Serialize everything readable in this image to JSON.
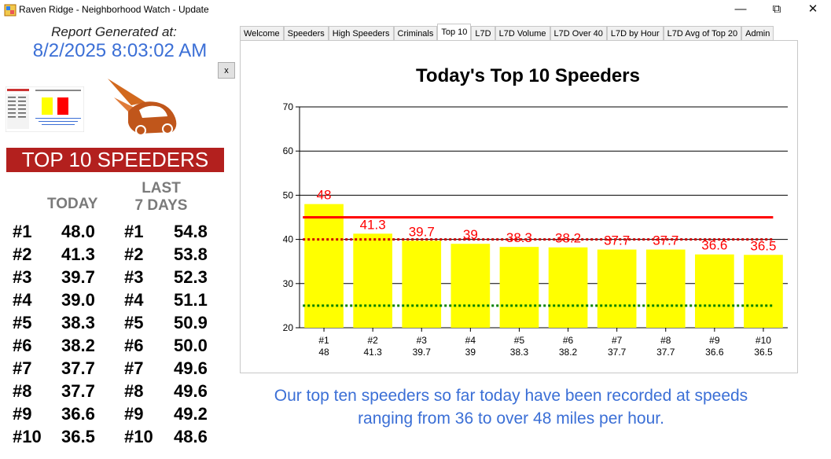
{
  "window": {
    "title": "Raven Ridge - Neighborhood Watch - Update"
  },
  "report": {
    "label": "Report Generated at:",
    "timestamp": "8/2/2025 8:03:02 AM",
    "close_label": "x"
  },
  "banner": {
    "text": "TOP 10 SPEEDERS"
  },
  "columns": {
    "today": "TODAY",
    "last_line1": "LAST",
    "last_line2": "7 DAYS"
  },
  "rankings": [
    {
      "today_rank": "#1",
      "today_speed": "48.0",
      "last_rank": "#1",
      "last_speed": "54.8"
    },
    {
      "today_rank": "#2",
      "today_speed": "41.3",
      "last_rank": "#2",
      "last_speed": "53.8"
    },
    {
      "today_rank": "#3",
      "today_speed": "39.7",
      "last_rank": "#3",
      "last_speed": "52.3"
    },
    {
      "today_rank": "#4",
      "today_speed": "39.0",
      "last_rank": "#4",
      "last_speed": "51.1"
    },
    {
      "today_rank": "#5",
      "today_speed": "38.3",
      "last_rank": "#5",
      "last_speed": "50.9"
    },
    {
      "today_rank": "#6",
      "today_speed": "38.2",
      "last_rank": "#6",
      "last_speed": "50.0"
    },
    {
      "today_rank": "#7",
      "today_speed": "37.7",
      "last_rank": "#7",
      "last_speed": "49.6"
    },
    {
      "today_rank": "#8",
      "today_speed": "37.7",
      "last_rank": "#8",
      "last_speed": "49.6"
    },
    {
      "today_rank": "#9",
      "today_speed": "36.6",
      "last_rank": "#9",
      "last_speed": "49.2"
    },
    {
      "today_rank": "#10",
      "today_speed": "36.5",
      "last_rank": "#10",
      "last_speed": "48.6"
    }
  ],
  "tabs": [
    {
      "label": "Welcome",
      "active": false
    },
    {
      "label": "Speeders",
      "active": false
    },
    {
      "label": "High Speeders",
      "active": false
    },
    {
      "label": "Criminals",
      "active": false
    },
    {
      "label": "Top 10",
      "active": true
    },
    {
      "label": "L7D",
      "active": false
    },
    {
      "label": "L7D Volume",
      "active": false
    },
    {
      "label": "L7D Over 40",
      "active": false
    },
    {
      "label": "L7D by Hour",
      "active": false
    },
    {
      "label": "L7D Avg of Top 20",
      "active": false
    },
    {
      "label": "Admin",
      "active": false
    }
  ],
  "chart_data": {
    "type": "bar",
    "title": "Today's Top 10 Speeders",
    "categories": [
      "#1",
      "#2",
      "#3",
      "#4",
      "#5",
      "#6",
      "#7",
      "#8",
      "#9",
      "#10"
    ],
    "category_sublabels": [
      "48",
      "41.3",
      "39.7",
      "39",
      "38.3",
      "38.2",
      "37.7",
      "37.7",
      "36.6",
      "36.5"
    ],
    "values": [
      48,
      41.3,
      39.7,
      39,
      38.3,
      38.2,
      37.7,
      37.7,
      36.6,
      36.5
    ],
    "data_labels": [
      "48",
      "41.3",
      "39.7",
      "39",
      "38.3",
      "38.2",
      "37.7",
      "37.7",
      "36.6",
      "36.5"
    ],
    "ylim": [
      20,
      70
    ],
    "yticks": [
      20,
      30,
      40,
      50,
      60,
      70
    ],
    "grid": true,
    "bar_color": "#ffff00",
    "label_color": "#ff0000",
    "reference_lines": [
      {
        "value": 45,
        "color": "#ff0000",
        "style": "solid"
      },
      {
        "value": 40,
        "color": "#cc0000",
        "style": "dotted"
      },
      {
        "value": 25,
        "color": "#008000",
        "style": "dotted"
      }
    ],
    "xlabel": "",
    "ylabel": ""
  },
  "caption": {
    "line1": "Our top ten speeders so far today have been recorded at speeds",
    "line2": "ranging from 36 to over 48 miles per hour."
  }
}
